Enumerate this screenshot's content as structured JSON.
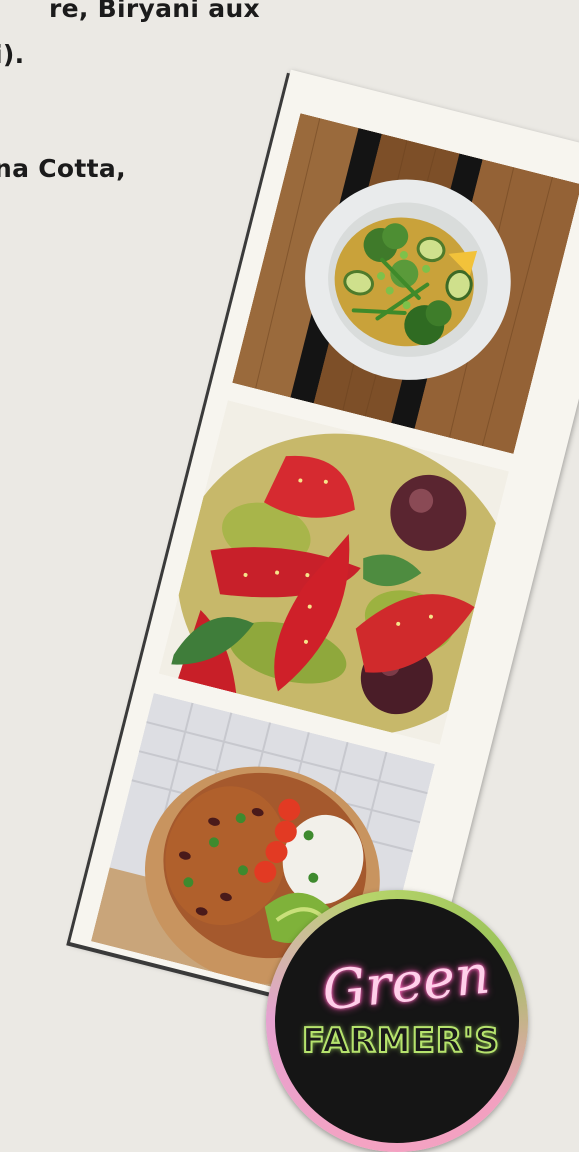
{
  "body_text": {
    "line_1": "re, Biryani aux",
    "line_2": "i).",
    "line_3": "na Cotta,"
  },
  "photos": [
    {
      "icon": "veggie-bowl-photo"
    },
    {
      "icon": "fruit-salad-photo"
    },
    {
      "icon": "chili-rice-bowl-photo"
    }
  ],
  "logo": {
    "script_text": "Green",
    "word_text": "FARMER'S"
  },
  "colors": {
    "background": "#ebe9e4",
    "text": "#1b1b1b",
    "logo_pink": "#ff6fc0",
    "logo_green": "#b6e36d"
  }
}
